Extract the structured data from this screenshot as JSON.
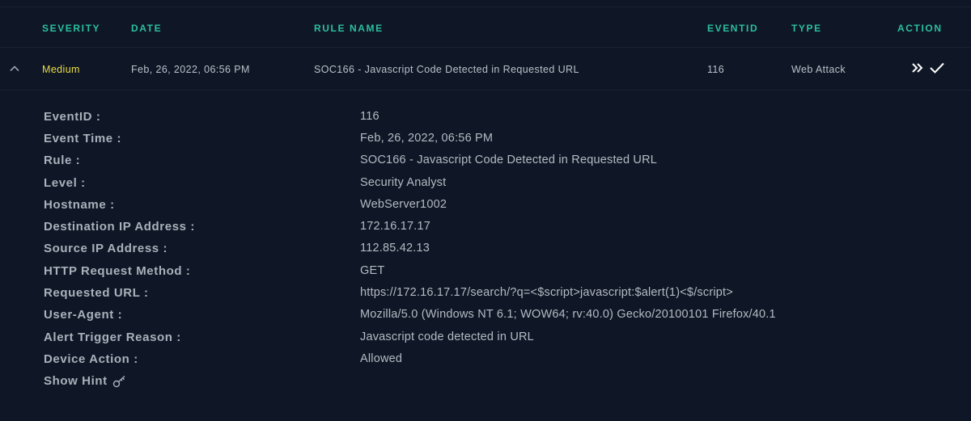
{
  "table": {
    "headers": [
      "SEVERITY",
      "DATE",
      "RULE NAME",
      "EVENTID",
      "TYPE",
      "ACTION"
    ],
    "row": {
      "severity": "Medium",
      "date": "Feb, 26, 2022, 06:56 PM",
      "rule_name": "SOC166 - Javascript Code Detected in Requested URL",
      "event_id": "116",
      "type": "Web Attack",
      "severity_color": "#e9dd46"
    }
  },
  "details": [
    {
      "label": "EventID :",
      "value": "116"
    },
    {
      "label": "Event Time :",
      "value": "Feb, 26, 2022, 06:56 PM"
    },
    {
      "label": "Rule :",
      "value": "SOC166 - Javascript Code Detected in Requested URL"
    },
    {
      "label": "Level :",
      "value": "Security Analyst"
    },
    {
      "label": "Hostname :",
      "value": "WebServer1002"
    },
    {
      "label": "Destination IP Address :",
      "value": "172.16.17.17"
    },
    {
      "label": "Source IP Address :",
      "value": "112.85.42.13"
    },
    {
      "label": "HTTP Request Method :",
      "value": "GET"
    },
    {
      "label": "Requested URL :",
      "value": "https://172.16.17.17/search/?q=<$script>javascript:$alert(1)<$/script>"
    },
    {
      "label": "User-Agent :",
      "value": "Mozilla/5.0 (Windows NT 6.1; WOW64; rv:40.0) Gecko/20100101 Firefox/40.1"
    },
    {
      "label": "Alert Trigger Reason :",
      "value": "Javascript code detected in URL"
    },
    {
      "label": "Device Action :",
      "value": "Allowed"
    }
  ],
  "hint": {
    "label": "Show Hint",
    "icon": "key-icon"
  },
  "icons": {
    "collapse": "chevron-up-icon",
    "escalate": "double-chevron-right-icon",
    "close": "checkmark-icon"
  },
  "colors": {
    "background": "#0f1726",
    "accent": "#2bbf9e"
  }
}
